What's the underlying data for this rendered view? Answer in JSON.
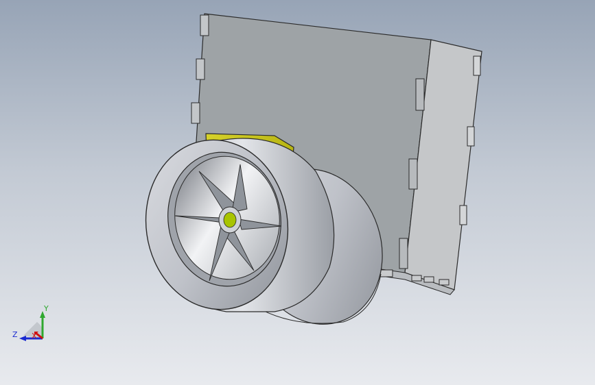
{
  "viewport": {
    "background_top": "#97a4b6",
    "background_bottom": "#e8eaee"
  },
  "model": {
    "body_color": "#9ea3a6",
    "side_panel_color": "#c9cbcd",
    "wheel_color": "#c7cad0",
    "motor_color": "#c2c100"
  },
  "triad": {
    "x_label": "X",
    "y_label": "Y",
    "z_label": "Z",
    "x_color": "#d01010",
    "y_color": "#2fa82f",
    "z_color": "#1a2ad0"
  }
}
